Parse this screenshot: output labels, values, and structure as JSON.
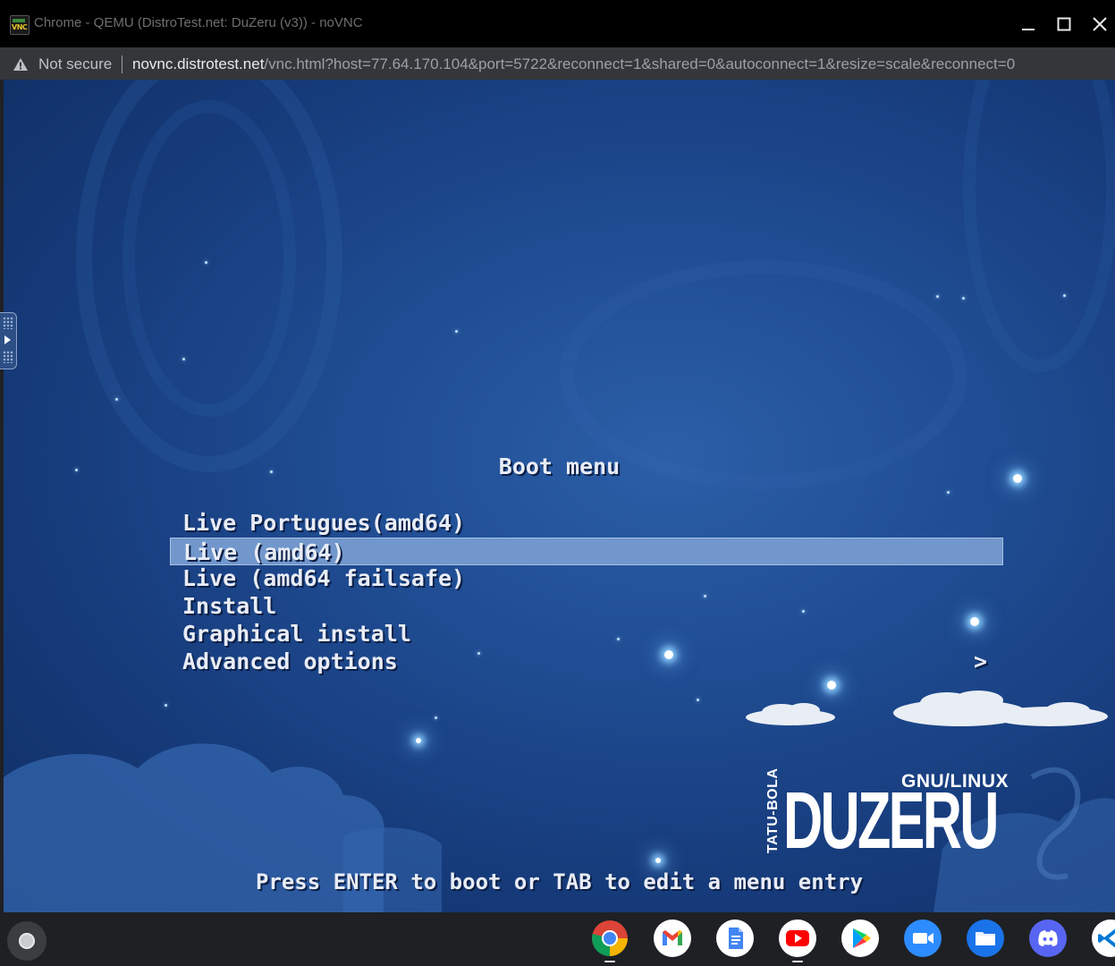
{
  "window": {
    "title": "Chrome - QEMU (DistroTest.net: DuZeru (v3)) - noVNC",
    "app_icon_text": "VNC",
    "controls": [
      "minimize",
      "maximize",
      "close"
    ]
  },
  "addressbar": {
    "security_label": "Not secure",
    "url_host": "novnc.distrotest.net",
    "url_path": "/vnc.html?host=77.64.170.104&port=5722&reconnect=1&shared=0&autoconnect=1&resize=scale&reconnect=0"
  },
  "boot": {
    "title": "Boot menu",
    "items": [
      {
        "label": "Live Portugues(amd64)",
        "selected": false
      },
      {
        "label": "Live (amd64)",
        "selected": true
      },
      {
        "label": "Live (amd64 failsafe)",
        "selected": false
      },
      {
        "label": "Install",
        "selected": false
      },
      {
        "label": "Graphical install",
        "selected": false
      },
      {
        "label": "Advanced options",
        "selected": false,
        "submenu": true
      }
    ],
    "submenu_arrow": ">",
    "hint": "Press ENTER to boot or TAB to edit a menu entry"
  },
  "logo": {
    "vertical_text": "TATU-BOLA",
    "tagline": "GNU/LINUX",
    "name": "DUZERU"
  },
  "shelf": {
    "apps": [
      "chrome-icon",
      "gmail-icon",
      "docs-icon",
      "youtube-icon",
      "play-store-icon",
      "zoom-icon",
      "files-icon",
      "discord-icon",
      "vscode-icon"
    ]
  },
  "colors": {
    "selected_row": "#7197cc",
    "boot_text": "#e8ecf5",
    "background_blue": "#1f4c92"
  }
}
